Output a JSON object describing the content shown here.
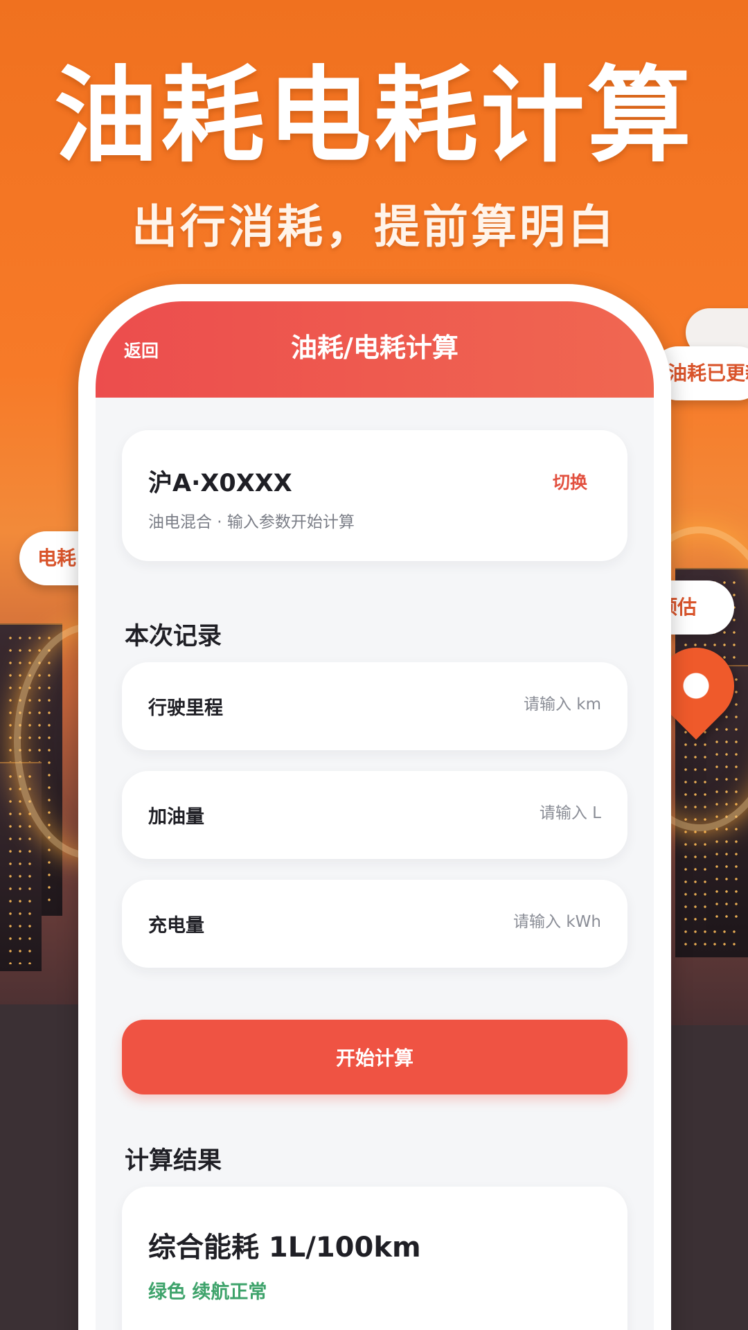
{
  "hero": {
    "title": "油耗电耗计算",
    "subtitle": "出行消耗，提前算明白"
  },
  "floating_tags": {
    "left": "电耗",
    "right_top": "油耗已更新",
    "right_mid": "预估"
  },
  "nav": {
    "back_label": "返回",
    "title": "油耗/电耗计算"
  },
  "vehicle": {
    "plate": "沪A·X0XXX",
    "switch_label": "切换",
    "description": "油电混合 · 输入参数开始计算"
  },
  "record": {
    "section_title": "本次记录",
    "fields": [
      {
        "label": "行驶里程",
        "placeholder": "请输入 km",
        "value": ""
      },
      {
        "label": "加油量",
        "placeholder": "请输入 L",
        "value": ""
      },
      {
        "label": "充电量",
        "placeholder": "请输入 kWh",
        "value": ""
      }
    ]
  },
  "action": {
    "calculate_label": "开始计算"
  },
  "result": {
    "section_title": "计算结果",
    "value": "综合能耗 1L/100km",
    "status": "绿色 续航正常"
  },
  "colors": {
    "nav_gradient_start": "#ec4d4d",
    "nav_gradient_end": "#f06751",
    "primary": "#ef5343",
    "switch": "#e2503f",
    "status_green": "#3ea36b"
  }
}
